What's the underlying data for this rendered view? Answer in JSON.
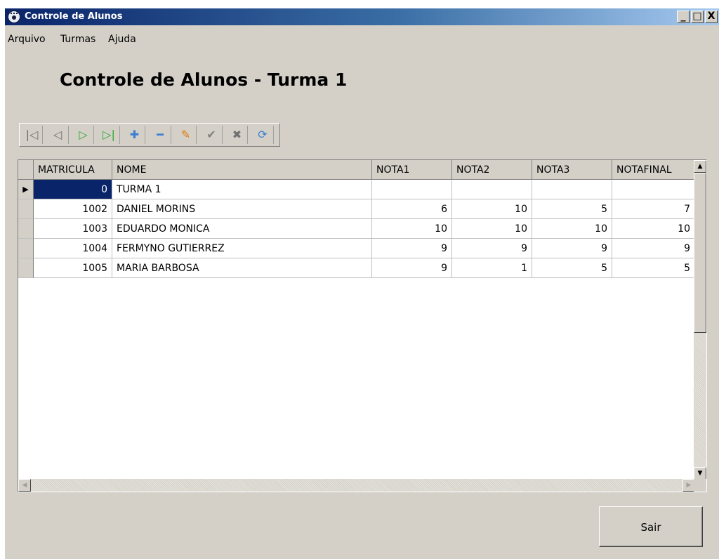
{
  "window": {
    "title": "Controle de Alunos",
    "controls": {
      "minimize": "_",
      "maximize": "□",
      "close": "X"
    }
  },
  "menu": {
    "items": [
      "Arquivo",
      "Turmas",
      "Ajuda"
    ]
  },
  "page": {
    "title": "Controle de Alunos - Turma 1"
  },
  "toolbar": {
    "buttons": [
      {
        "icon": "first-record-icon",
        "glyph": "|◁",
        "color": "#707070"
      },
      {
        "icon": "prior-record-icon",
        "glyph": "◁",
        "color": "#707070"
      },
      {
        "icon": "next-record-icon",
        "glyph": "▷",
        "color": "#2ea82e"
      },
      {
        "icon": "last-record-icon",
        "glyph": "▷|",
        "color": "#2ea82e"
      },
      {
        "icon": "insert-icon",
        "glyph": "✚",
        "color": "#3b7fd4"
      },
      {
        "icon": "delete-icon",
        "glyph": "━",
        "color": "#3b7fd4"
      },
      {
        "icon": "edit-icon",
        "glyph": "✎",
        "color": "#e07b10"
      },
      {
        "icon": "post-icon",
        "glyph": "✔",
        "color": "#808080"
      },
      {
        "icon": "cancel-icon",
        "glyph": "✖",
        "color": "#707070"
      },
      {
        "icon": "refresh-icon",
        "glyph": "⟳",
        "color": "#3b7fd4"
      }
    ]
  },
  "grid": {
    "columns": [
      "MATRICULA",
      "NOME",
      "NOTA1",
      "NOTA2",
      "NOTA3",
      "NOTAFINAL"
    ],
    "rows": [
      {
        "matricula": "0",
        "nome": "TURMA 1",
        "nota1": "",
        "nota2": "",
        "nota3": "",
        "notafinal": ""
      },
      {
        "matricula": "1002",
        "nome": "DANIEL MORINS",
        "nota1": "6",
        "nota2": "10",
        "nota3": "5",
        "notafinal": "7"
      },
      {
        "matricula": "1003",
        "nome": "EDUARDO MONICA",
        "nota1": "10",
        "nota2": "10",
        "nota3": "10",
        "notafinal": "10"
      },
      {
        "matricula": "1004",
        "nome": "FERMYNO GUTIERREZ",
        "nota1": "9",
        "nota2": "9",
        "nota3": "9",
        "notafinal": "9"
      },
      {
        "matricula": "1005",
        "nome": "MARIA BARBOSA",
        "nota1": "9",
        "nota2": "1",
        "nota3": "5",
        "notafinal": "5"
      }
    ]
  },
  "footer": {
    "exit_label": "Sair"
  }
}
